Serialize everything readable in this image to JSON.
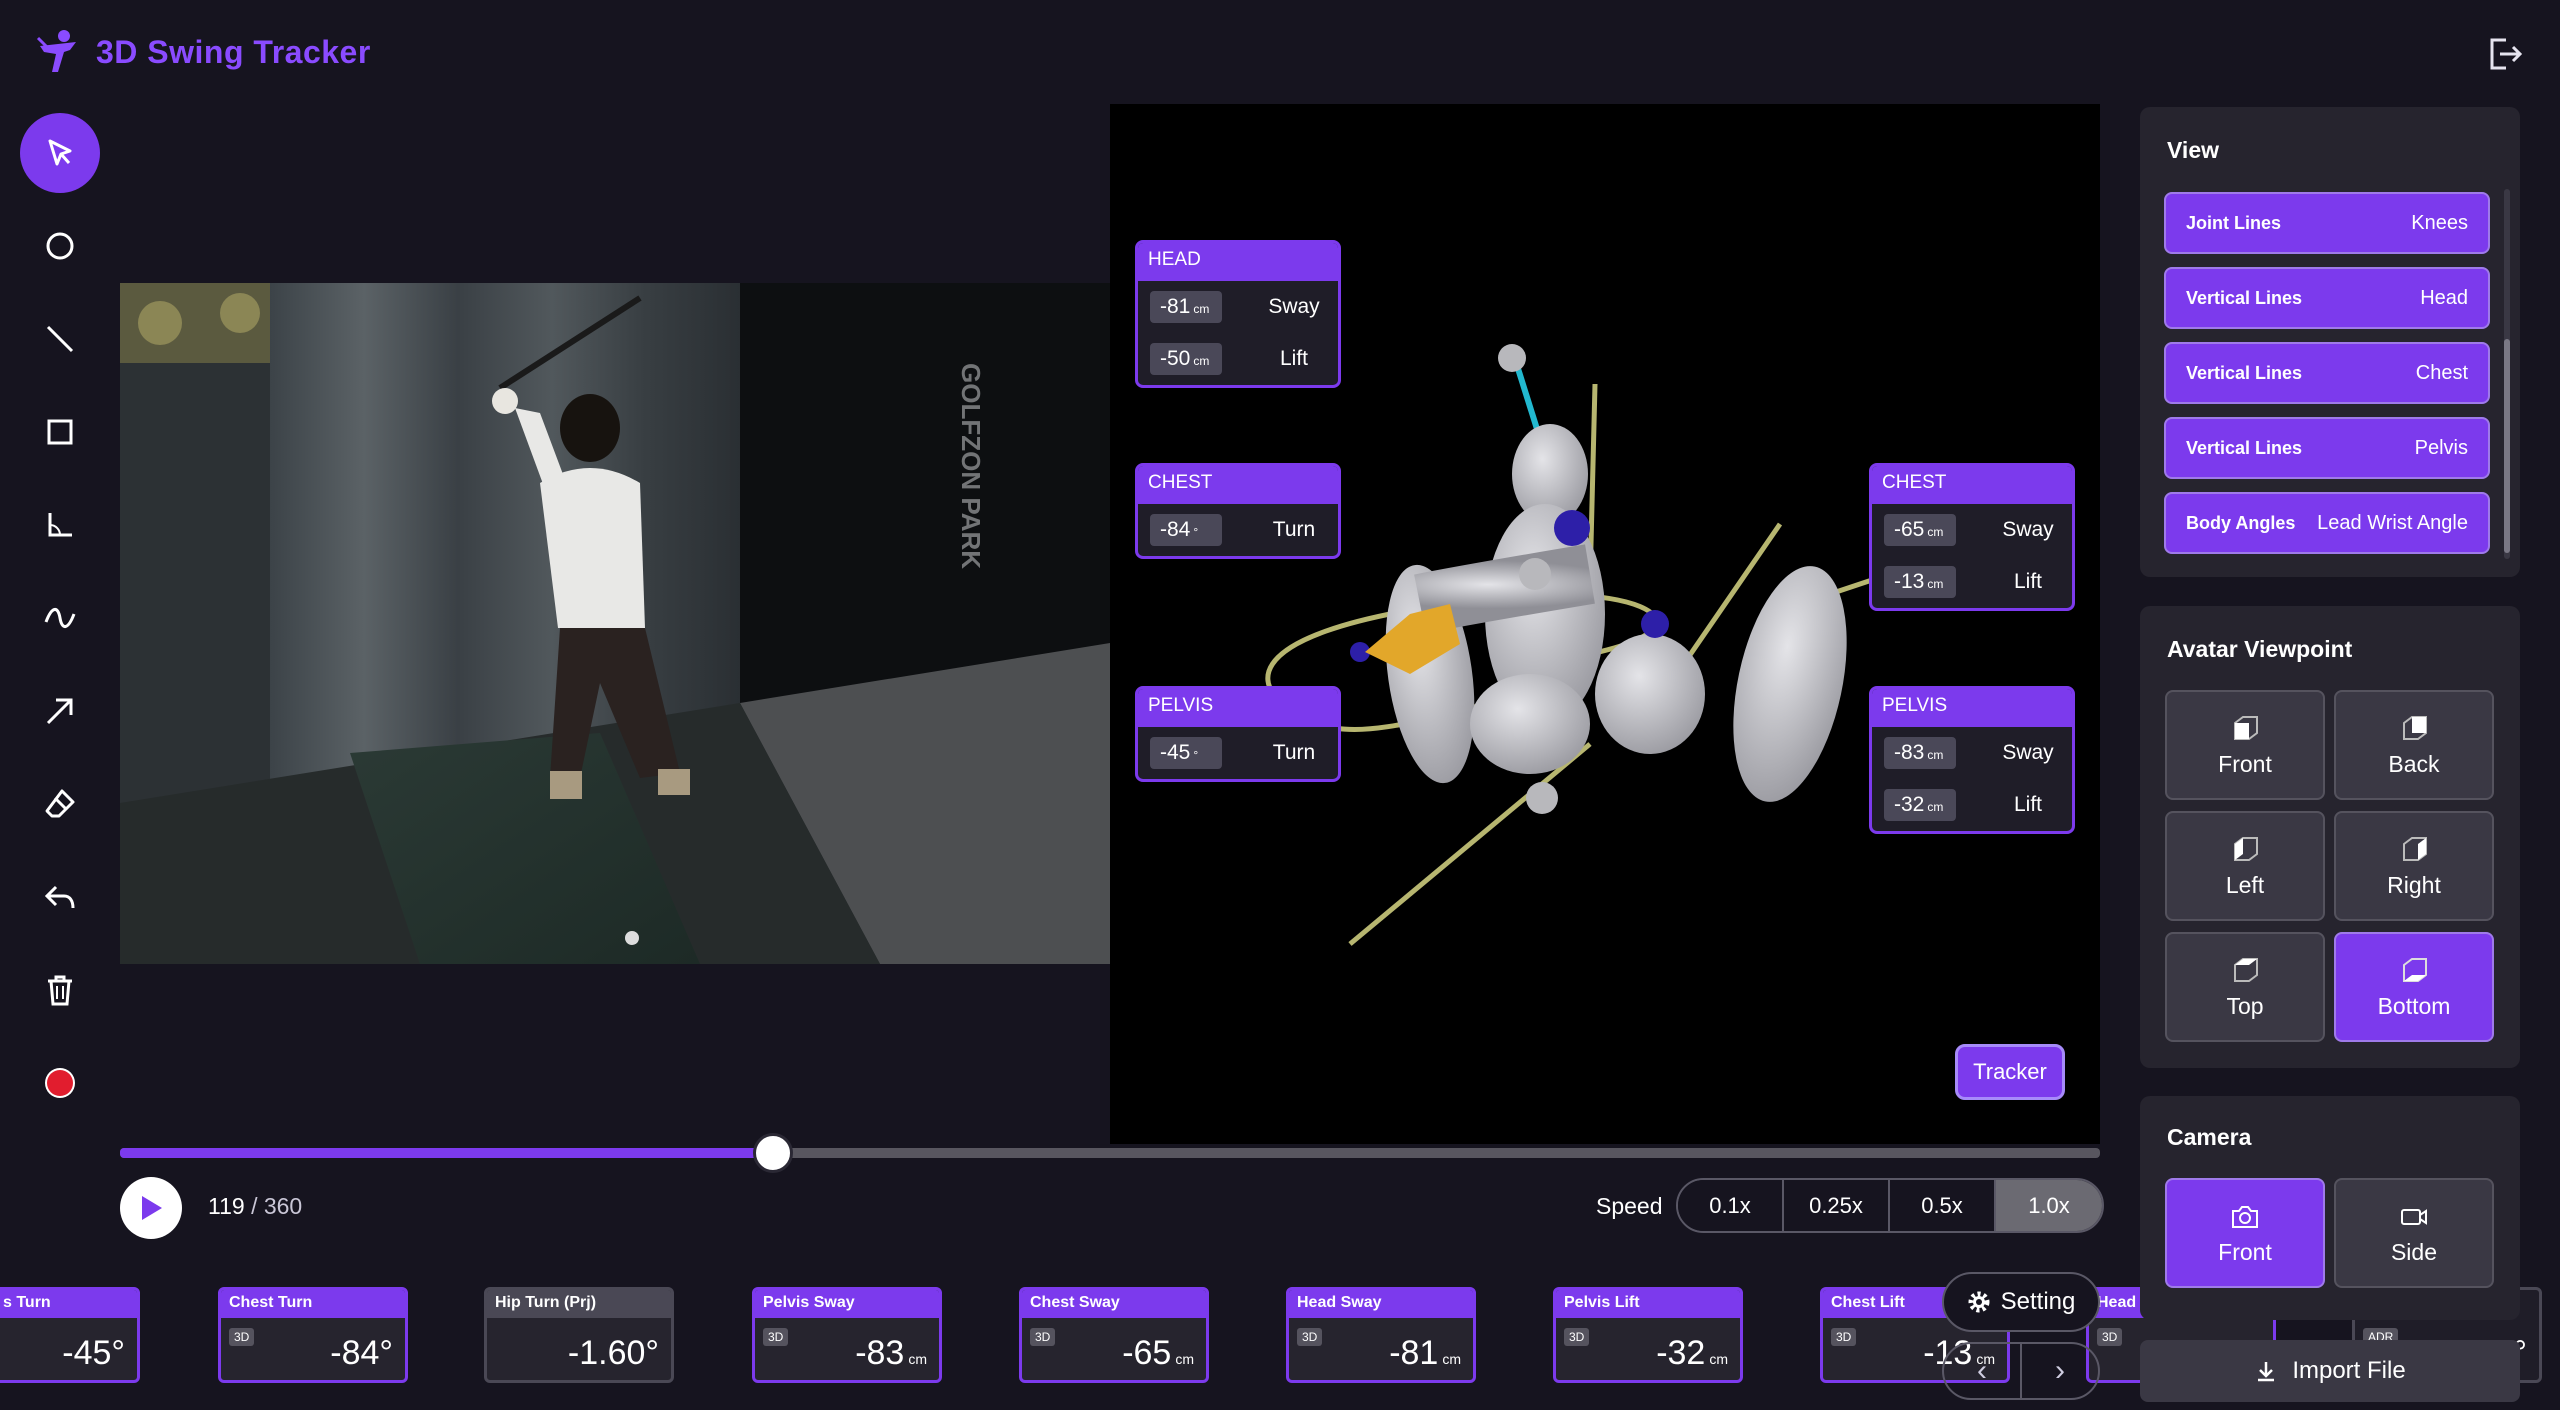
{
  "app": {
    "title": "3D Swing Tracker"
  },
  "toolbar": {
    "tools": [
      "pointer-icon",
      "circle-icon",
      "line-icon",
      "rectangle-icon",
      "angle-icon",
      "curve-icon",
      "arrow-icon",
      "eraser-icon",
      "undo-icon",
      "trash-icon",
      "record-icon"
    ]
  },
  "video": {
    "watermark": "GOLFZON PARK"
  },
  "overlay": {
    "head": {
      "title": "HEAD",
      "sway": "-81",
      "sway_unit": "cm",
      "sway_label": "Sway",
      "lift": "-50",
      "lift_unit": "cm",
      "lift_label": "Lift"
    },
    "chest_left": {
      "title": "CHEST",
      "turn": "-84",
      "turn_unit": "°",
      "turn_label": "Turn"
    },
    "pelvis_left": {
      "title": "PELVIS",
      "turn": "-45",
      "turn_unit": "°",
      "turn_label": "Turn"
    },
    "chest_right": {
      "title": "CHEST",
      "sway": "-65",
      "sway_unit": "cm",
      "sway_label": "Sway",
      "lift": "-13",
      "lift_unit": "cm",
      "lift_label": "Lift"
    },
    "pelvis_right": {
      "title": "PELVIS",
      "sway": "-83",
      "sway_unit": "cm",
      "sway_label": "Sway",
      "lift": "-32",
      "lift_unit": "cm",
      "lift_label": "Lift"
    },
    "tracker_label": "Tracker"
  },
  "playback": {
    "current_frame": "119",
    "total_frames": "/ 360",
    "progress": 0.33,
    "speed_label": "Speed",
    "speeds": [
      "0.1x",
      "0.25x",
      "0.5x",
      "1.0x"
    ],
    "selected_speed": "1.0x"
  },
  "metrics": [
    {
      "label": "s Turn",
      "badge": "",
      "value": "-45",
      "unit": "°"
    },
    {
      "label": "Chest Turn",
      "badge": "3D",
      "value": "-84",
      "unit": "°"
    },
    {
      "label": "Hip Turn (Prj)",
      "badge": "",
      "value": "-1.60",
      "unit": "°"
    },
    {
      "label": "Pelvis Sway",
      "badge": "3D",
      "value": "-83",
      "unit": "cm"
    },
    {
      "label": "Chest Sway",
      "badge": "3D",
      "value": "-65",
      "unit": "cm"
    },
    {
      "label": "Head Sway",
      "badge": "3D",
      "value": "-81",
      "unit": "cm"
    },
    {
      "label": "Pelvis Lift",
      "badge": "3D",
      "value": "-32",
      "unit": "cm"
    },
    {
      "label": "Chest Lift",
      "badge": "3D",
      "value": "-13",
      "unit": "cm"
    },
    {
      "label": "Head L",
      "badge": "3D",
      "value": "",
      "unit": ""
    },
    {
      "label": "",
      "badge": "ADR",
      "value": "",
      "unit": "°"
    }
  ],
  "setting": {
    "label": "Setting"
  },
  "view_panel": {
    "title": "View",
    "items": [
      {
        "category": "Joint Lines",
        "value": "Knees"
      },
      {
        "category": "Vertical Lines",
        "value": "Head"
      },
      {
        "category": "Vertical Lines",
        "value": "Chest"
      },
      {
        "category": "Vertical Lines",
        "value": "Pelvis"
      },
      {
        "category": "Body Angles",
        "value": "Lead Wrist Angle"
      }
    ]
  },
  "avatar_panel": {
    "title": "Avatar Viewpoint",
    "options": [
      "Front",
      "Back",
      "Left",
      "Right",
      "Top",
      "Bottom"
    ],
    "selected": "Bottom"
  },
  "camera_panel": {
    "title": "Camera",
    "options": [
      "Front",
      "Side"
    ],
    "selected": "Front"
  },
  "import": {
    "label": "Import File"
  },
  "colors": {
    "accent": "#7c3aed",
    "background": "#16141f",
    "panel": "#26242e",
    "record": "#e11d2e"
  }
}
